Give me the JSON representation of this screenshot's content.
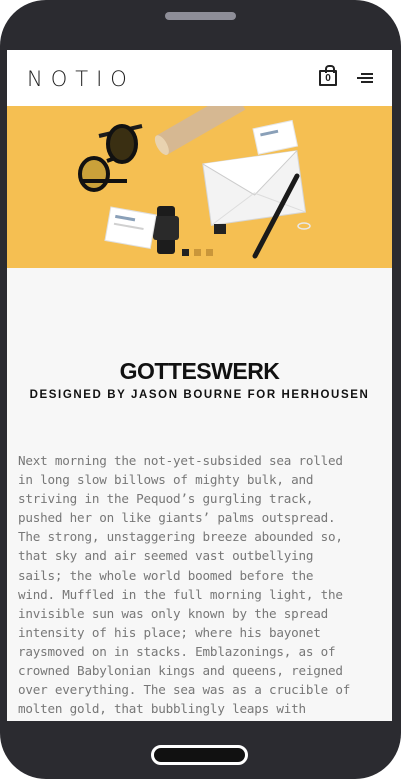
{
  "header": {
    "logo": "NOTIO",
    "cart_count": "0"
  },
  "hero": {
    "slides": 3,
    "active_slide": 1,
    "background": "#f5bf52"
  },
  "project": {
    "title": "GOTTESWERK",
    "subtitle": "DESIGNED BY JASON BOURNE FOR HERHOUSEN",
    "body_lines": [
      "Next morning the not-yet-subsided sea rolled",
      "in long slow billows of mighty bulk, and",
      "striving in the Pequod’s gurgling track,",
      "pushed her on like giants’ palms outspread.",
      "The strong, unstaggering breeze abounded so,",
      "that sky and air seemed vast outbellying",
      "sails; the whole world boomed before the",
      "wind. Muffled in the full morning light, the",
      "invisible sun was only known by the spread",
      "intensity of his place; where his bayonet",
      "raysmoved on in stacks. Emblazonings, as of",
      "crowned Babylonian kings and queens, reigned",
      "over everything. The sea was as a crucible of",
      "molten gold, that bubblingly leaps with"
    ]
  }
}
